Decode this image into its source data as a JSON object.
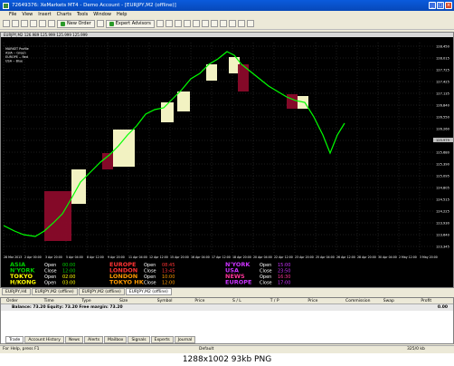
{
  "window": {
    "title": "72649376: XeMarkets MT4 - Demo Account - [EURJPY,M2 (offline)]"
  },
  "menu": [
    "File",
    "View",
    "Insert",
    "Charts",
    "Tools",
    "Window",
    "Help"
  ],
  "toolbar": {
    "new_order": "New Order",
    "expert_advisors": "Expert Advisors"
  },
  "chart": {
    "header": "EURJPY,M2  126.989 125.999 125.999 125.999",
    "indicator_lines": [
      "MARKET Profile",
      "ASIA      -- Green",
      "EUROPE -- Red",
      "USA       -- Blue"
    ],
    "price_labels": [
      "128.450",
      "128.015",
      "127.725",
      "127.425",
      "127.135",
      "126.840",
      "126.550",
      "126.260",
      "125.970",
      "125.680",
      "125.390",
      "125.095",
      "124.805",
      "124.515",
      "124.225",
      "123.930",
      "123.640",
      "123.345"
    ],
    "current_price": "125.979",
    "time_labels": [
      "28 Mar 2013",
      "2 Apr 00:00",
      "3 Apr 20:00",
      "5 Apr 04:00",
      "8 Apr 12:00",
      "9 Apr 20:00",
      "11 Apr 04:00",
      "12 Apr 12:00",
      "15 Apr 20:00",
      "16 Apr 04:00",
      "17 Apr 12:00",
      "18 Apr 20:00",
      "20 Apr 04:00",
      "22 Apr 12:00",
      "23 Apr 20:00",
      "25 Apr 04:00",
      "26 Apr 12:00",
      "28 Apr 20:00",
      "30 Apr 04:00",
      "2 May 12:00",
      "3 May 20:00"
    ],
    "sessions": {
      "col1": [
        {
          "name": "ASIA",
          "label": "Open",
          "time": "00:00",
          "color": "#00cc00"
        },
        {
          "name": "N'YORK",
          "label": "Close",
          "time": "12:00",
          "color": "#00cc00"
        },
        {
          "name": "TOKYO",
          "label": "Open",
          "time": "02:00",
          "color": "#ffff00"
        },
        {
          "name": "H/KONG",
          "label": "Open",
          "time": "03:00",
          "color": "#ffff00"
        }
      ],
      "col2": [
        {
          "name": "EUROPE",
          "label": "Open",
          "time": "08:45",
          "color": "#ff3333"
        },
        {
          "name": "LONDON",
          "label": "Close",
          "time": "13:45",
          "color": "#ff3333"
        },
        {
          "name": "LONDON",
          "label": "Open",
          "time": "10:00",
          "color": "#ff9900"
        },
        {
          "name": "TOKYO HK",
          "label": "Close",
          "time": "12:00",
          "color": "#ff9900"
        }
      ],
      "col3": [
        {
          "name": "N'YORK",
          "label": "Open",
          "time": "15:00",
          "color": "#cc33ff"
        },
        {
          "name": "USA",
          "label": "Close",
          "time": "23:50",
          "color": "#cc33ff"
        },
        {
          "name": "NEWS",
          "label": "Open",
          "time": "16:30",
          "color": "#ff3399"
        },
        {
          "name": "EUROPE",
          "label": "Close",
          "time": "17:00",
          "color": "#cc33ff"
        }
      ]
    }
  },
  "chart_tabs": [
    "EURJPY,H4",
    "EURJPY,M2 (offline)",
    "EURJPY,M2 (offline)",
    "EURJPY,M2 (offline)"
  ],
  "terminal": {
    "columns": [
      "Order",
      "Time",
      "Type",
      "Size",
      "Symbol",
      "Price",
      "S / L",
      "T / P",
      "Price",
      "Commission",
      "Swap",
      "Profit"
    ],
    "balance_row": "Balance: 73.20  Equity: 73.20  Free margin: 73.20",
    "profit": "0.00"
  },
  "bottom_tabs": [
    "Trade",
    "Account History",
    "News",
    "Alerts",
    "Mailbox",
    "Signals",
    "Experts",
    "Journal"
  ],
  "status": {
    "help": "For Help, press F1",
    "profile": "Default",
    "traffic": "325/0 kb"
  },
  "caption": "1288x1002  93kb  PNG",
  "colors": {
    "chart_bg": "#000000",
    "candle": "#00ff00",
    "asia_box": "#ffffcc",
    "europe_box": "#8b0a2a"
  }
}
